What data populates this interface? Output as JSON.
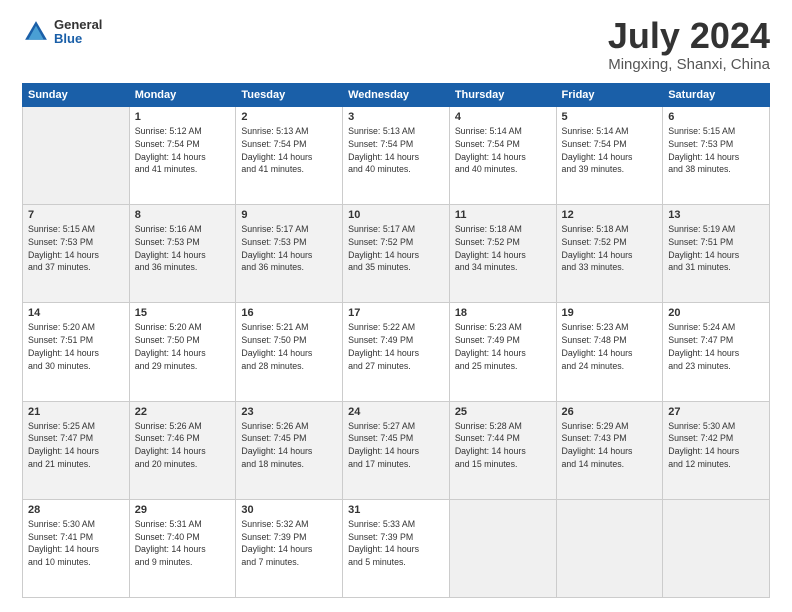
{
  "header": {
    "logo_general": "General",
    "logo_blue": "Blue",
    "title": "July 2024",
    "location": "Mingxing, Shanxi, China"
  },
  "days_of_week": [
    "Sunday",
    "Monday",
    "Tuesday",
    "Wednesday",
    "Thursday",
    "Friday",
    "Saturday"
  ],
  "weeks": [
    [
      {
        "day": "",
        "info": ""
      },
      {
        "day": "1",
        "info": "Sunrise: 5:12 AM\nSunset: 7:54 PM\nDaylight: 14 hours\nand 41 minutes."
      },
      {
        "day": "2",
        "info": "Sunrise: 5:13 AM\nSunset: 7:54 PM\nDaylight: 14 hours\nand 41 minutes."
      },
      {
        "day": "3",
        "info": "Sunrise: 5:13 AM\nSunset: 7:54 PM\nDaylight: 14 hours\nand 40 minutes."
      },
      {
        "day": "4",
        "info": "Sunrise: 5:14 AM\nSunset: 7:54 PM\nDaylight: 14 hours\nand 40 minutes."
      },
      {
        "day": "5",
        "info": "Sunrise: 5:14 AM\nSunset: 7:54 PM\nDaylight: 14 hours\nand 39 minutes."
      },
      {
        "day": "6",
        "info": "Sunrise: 5:15 AM\nSunset: 7:53 PM\nDaylight: 14 hours\nand 38 minutes."
      }
    ],
    [
      {
        "day": "7",
        "info": "Sunrise: 5:15 AM\nSunset: 7:53 PM\nDaylight: 14 hours\nand 37 minutes."
      },
      {
        "day": "8",
        "info": "Sunrise: 5:16 AM\nSunset: 7:53 PM\nDaylight: 14 hours\nand 36 minutes."
      },
      {
        "day": "9",
        "info": "Sunrise: 5:17 AM\nSunset: 7:53 PM\nDaylight: 14 hours\nand 36 minutes."
      },
      {
        "day": "10",
        "info": "Sunrise: 5:17 AM\nSunset: 7:52 PM\nDaylight: 14 hours\nand 35 minutes."
      },
      {
        "day": "11",
        "info": "Sunrise: 5:18 AM\nSunset: 7:52 PM\nDaylight: 14 hours\nand 34 minutes."
      },
      {
        "day": "12",
        "info": "Sunrise: 5:18 AM\nSunset: 7:52 PM\nDaylight: 14 hours\nand 33 minutes."
      },
      {
        "day": "13",
        "info": "Sunrise: 5:19 AM\nSunset: 7:51 PM\nDaylight: 14 hours\nand 31 minutes."
      }
    ],
    [
      {
        "day": "14",
        "info": "Sunrise: 5:20 AM\nSunset: 7:51 PM\nDaylight: 14 hours\nand 30 minutes."
      },
      {
        "day": "15",
        "info": "Sunrise: 5:20 AM\nSunset: 7:50 PM\nDaylight: 14 hours\nand 29 minutes."
      },
      {
        "day": "16",
        "info": "Sunrise: 5:21 AM\nSunset: 7:50 PM\nDaylight: 14 hours\nand 28 minutes."
      },
      {
        "day": "17",
        "info": "Sunrise: 5:22 AM\nSunset: 7:49 PM\nDaylight: 14 hours\nand 27 minutes."
      },
      {
        "day": "18",
        "info": "Sunrise: 5:23 AM\nSunset: 7:49 PM\nDaylight: 14 hours\nand 25 minutes."
      },
      {
        "day": "19",
        "info": "Sunrise: 5:23 AM\nSunset: 7:48 PM\nDaylight: 14 hours\nand 24 minutes."
      },
      {
        "day": "20",
        "info": "Sunrise: 5:24 AM\nSunset: 7:47 PM\nDaylight: 14 hours\nand 23 minutes."
      }
    ],
    [
      {
        "day": "21",
        "info": "Sunrise: 5:25 AM\nSunset: 7:47 PM\nDaylight: 14 hours\nand 21 minutes."
      },
      {
        "day": "22",
        "info": "Sunrise: 5:26 AM\nSunset: 7:46 PM\nDaylight: 14 hours\nand 20 minutes."
      },
      {
        "day": "23",
        "info": "Sunrise: 5:26 AM\nSunset: 7:45 PM\nDaylight: 14 hours\nand 18 minutes."
      },
      {
        "day": "24",
        "info": "Sunrise: 5:27 AM\nSunset: 7:45 PM\nDaylight: 14 hours\nand 17 minutes."
      },
      {
        "day": "25",
        "info": "Sunrise: 5:28 AM\nSunset: 7:44 PM\nDaylight: 14 hours\nand 15 minutes."
      },
      {
        "day": "26",
        "info": "Sunrise: 5:29 AM\nSunset: 7:43 PM\nDaylight: 14 hours\nand 14 minutes."
      },
      {
        "day": "27",
        "info": "Sunrise: 5:30 AM\nSunset: 7:42 PM\nDaylight: 14 hours\nand 12 minutes."
      }
    ],
    [
      {
        "day": "28",
        "info": "Sunrise: 5:30 AM\nSunset: 7:41 PM\nDaylight: 14 hours\nand 10 minutes."
      },
      {
        "day": "29",
        "info": "Sunrise: 5:31 AM\nSunset: 7:40 PM\nDaylight: 14 hours\nand 9 minutes."
      },
      {
        "day": "30",
        "info": "Sunrise: 5:32 AM\nSunset: 7:39 PM\nDaylight: 14 hours\nand 7 minutes."
      },
      {
        "day": "31",
        "info": "Sunrise: 5:33 AM\nSunset: 7:39 PM\nDaylight: 14 hours\nand 5 minutes."
      },
      {
        "day": "",
        "info": ""
      },
      {
        "day": "",
        "info": ""
      },
      {
        "day": "",
        "info": ""
      }
    ]
  ]
}
